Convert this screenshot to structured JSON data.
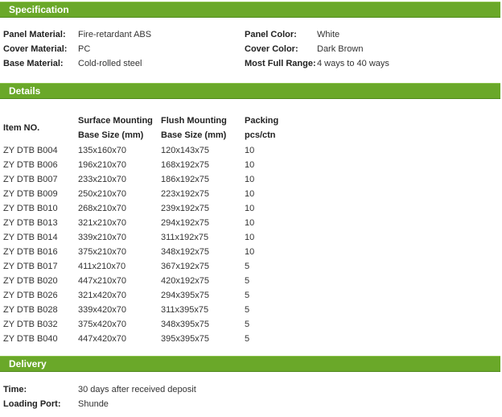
{
  "specification": {
    "title": "Specification",
    "left_rows": [
      {
        "label": "Panel Material:",
        "value": "Fire-retardant ABS"
      },
      {
        "label": "Cover Material:",
        "value": "PC"
      },
      {
        "label": "Base Material:",
        "value": "Cold-rolled steel"
      }
    ],
    "right_rows": [
      {
        "label": "Panel Color:",
        "value": "White"
      },
      {
        "label": "Cover Color:",
        "value": "Dark Brown"
      },
      {
        "label": "Most Full Range:",
        "value": "4 ways to 40 ways"
      }
    ]
  },
  "details": {
    "title": "Details",
    "headers": {
      "item": "Item NO.",
      "surface_line1": "Surface Mounting",
      "surface_line2": "Base Size (mm)",
      "flush_line1": "Flush Mounting",
      "flush_line2": "Base Size (mm)",
      "packing_line1": "Packing",
      "packing_line2": "pcs/ctn"
    },
    "rows": [
      {
        "item": "ZY DTB B004",
        "surface": "135x160x70",
        "flush": "120x143x75",
        "packing": "10"
      },
      {
        "item": "ZY DTB B006",
        "surface": "196x210x70",
        "flush": "168x192x75",
        "packing": "10"
      },
      {
        "item": "ZY DTB B007",
        "surface": "233x210x70",
        "flush": "186x192x75",
        "packing": "10"
      },
      {
        "item": "ZY DTB B009",
        "surface": "250x210x70",
        "flush": "223x192x75",
        "packing": "10"
      },
      {
        "item": "ZY DTB B010",
        "surface": "268x210x70",
        "flush": "239x192x75",
        "packing": "10"
      },
      {
        "item": "ZY DTB B013",
        "surface": "321x210x70",
        "flush": "294x192x75",
        "packing": "10"
      },
      {
        "item": "ZY DTB B014",
        "surface": "339x210x70",
        "flush": "311x192x75",
        "packing": "10"
      },
      {
        "item": "ZY DTB B016",
        "surface": "375x210x70",
        "flush": "348x192x75",
        "packing": "10"
      },
      {
        "item": "ZY DTB B017",
        "surface": "411x210x70",
        "flush": "367x192x75",
        "packing": "5"
      },
      {
        "item": "ZY DTB B020",
        "surface": "447x210x70",
        "flush": "420x192x75",
        "packing": "5"
      },
      {
        "item": "ZY DTB B026",
        "surface": "321x420x70",
        "flush": "294x395x75",
        "packing": "5"
      },
      {
        "item": "ZY DTB B028",
        "surface": "339x420x70",
        "flush": "311x395x75",
        "packing": "5"
      },
      {
        "item": "ZY DTB B032",
        "surface": "375x420x70",
        "flush": "348x395x75",
        "packing": "5"
      },
      {
        "item": "ZY DTB B040",
        "surface": "447x420x70",
        "flush": "395x395x75",
        "packing": "5"
      }
    ]
  },
  "delivery": {
    "title": "Delivery",
    "rows": [
      {
        "label": "Time:",
        "value": "30 days after received deposit"
      },
      {
        "label": "Loading Port:",
        "value": "Shunde"
      }
    ]
  },
  "colors": {
    "section_bar": "#6aa829",
    "section_text": "#ffffff"
  }
}
